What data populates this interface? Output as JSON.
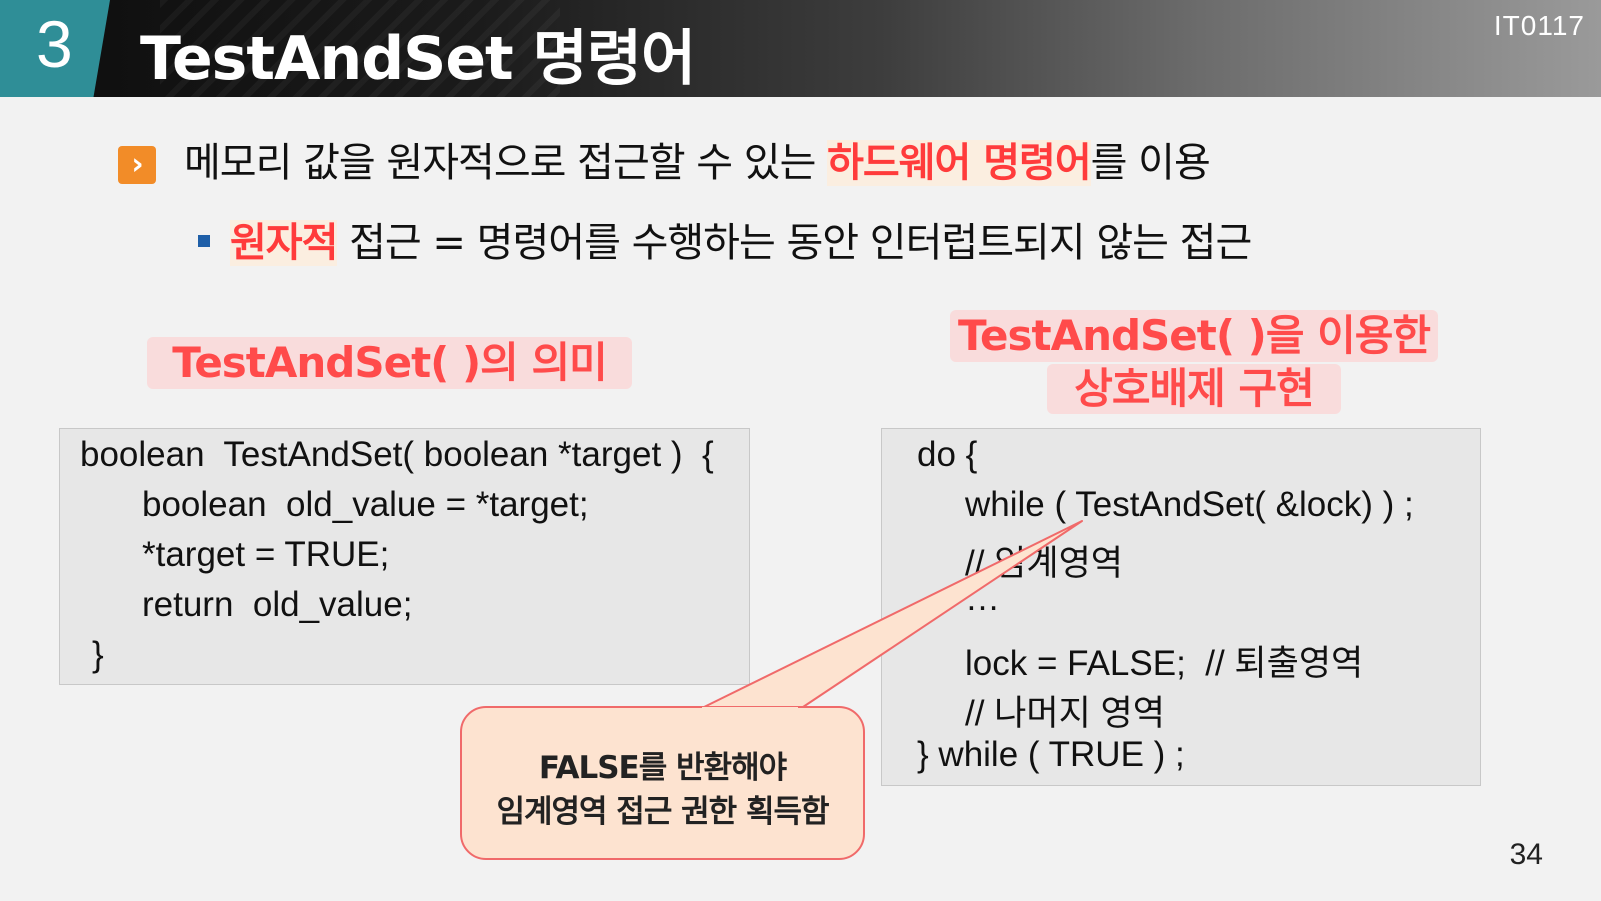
{
  "header": {
    "section_number": "3",
    "title": "TestAndSet 명령어",
    "course_code": "IT0117"
  },
  "bullets": {
    "main": {
      "text_before": "메모리 값을 원자적으로 접근할 수 있는 ",
      "highlight": "하드웨어 명령어",
      "text_after": "를 이용"
    },
    "sub": {
      "highlight": "원자적",
      "text_after": " 접근 = 명령어를 수행하는 동안 인터럽트되지 않는 접근"
    }
  },
  "left_panel": {
    "label": "TestAndSet( )의 의미",
    "code": [
      "boolean  TestAndSet( boolean *target )  {",
      "boolean  old_value = *target;",
      "*target = TRUE;",
      "return  old_value;",
      "}"
    ]
  },
  "right_panel": {
    "label_line1": "TestAndSet( )을 이용한",
    "label_line2": "상호배제 구현",
    "code": [
      "do {",
      "while ( TestAndSet( &lock) ) ;",
      "// 임계영역",
      "…",
      "lock = FALSE;  // 퇴출영역",
      "// 나머지 영역",
      "} while ( TRUE ) ;"
    ]
  },
  "callout": {
    "line1": "FALSE를 반환해야",
    "line2": "임계영역 접근 권한 획득함"
  },
  "page_number": "34",
  "colors": {
    "accent_teal": "#2f8e97",
    "highlight_red": "#ff3b3b",
    "bullet_orange": "#f28c28",
    "bullet_blue": "#1f5fa8",
    "callout_fill": "#fde3d0",
    "callout_border": "#f06a6a"
  }
}
